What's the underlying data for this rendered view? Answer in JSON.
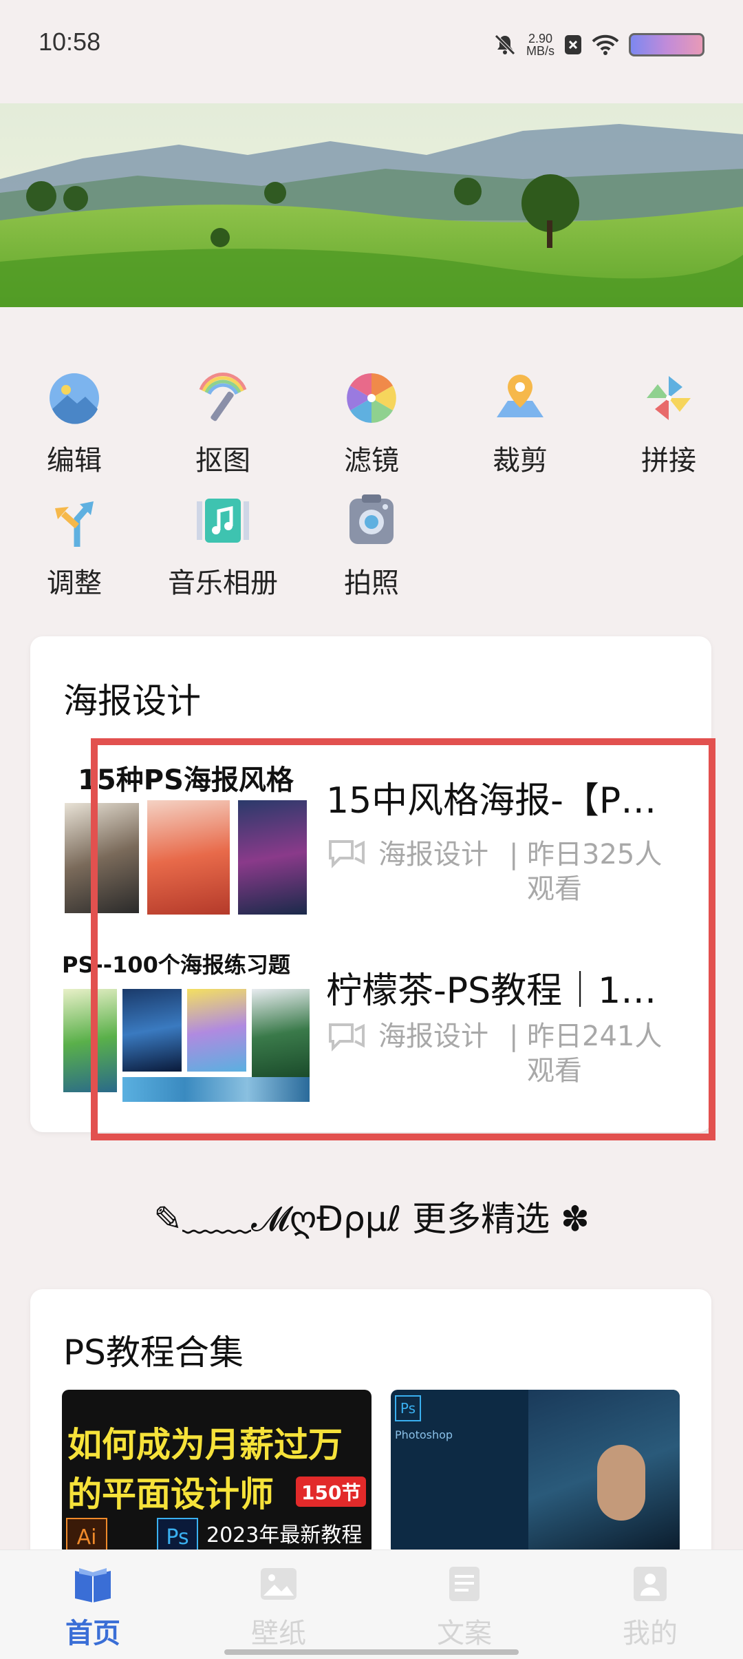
{
  "status_bar": {
    "time": "10:58",
    "net_speed_value": "2.90",
    "net_speed_unit": "MB/s"
  },
  "tools": [
    {
      "label": "编辑",
      "icon": "landscape-photo-icon"
    },
    {
      "label": "抠图",
      "icon": "magic-wand-icon"
    },
    {
      "label": "滤镜",
      "icon": "color-wheel-icon"
    },
    {
      "label": "裁剪",
      "icon": "map-pin-icon"
    },
    {
      "label": "拼接",
      "icon": "pinwheel-icon"
    },
    {
      "label": "调整",
      "icon": "split-arrow-icon"
    },
    {
      "label": "音乐相册",
      "icon": "music-album-icon"
    },
    {
      "label": "拍照",
      "icon": "camera-icon"
    }
  ],
  "poster_section": {
    "title": "海报设计",
    "items": [
      {
        "thumb_text": "15种PS海报风格",
        "title": "15中风格海报-【P…",
        "category": "海报设计",
        "stats_line1": "昨日325人",
        "stats_line2": "观看"
      },
      {
        "thumb_text": "PS--100个海报练习题",
        "title": "柠檬茶-PS教程｜1…",
        "category": "海报设计",
        "stats_line1": "昨日241人",
        "stats_line2": "观看"
      }
    ]
  },
  "more_picks": "✎﹏﹏𝓜ღĐρµℓ 更多精选 ✽",
  "ps_section": {
    "title": "PS教程合集",
    "card1_line1": "如何成为月薪过万",
    "card1_line2": "的平面设计师",
    "card1_badge": "150节",
    "card1_sub": "2023年最新教程",
    "card2_label": "Photoshop"
  },
  "bottom_nav": [
    {
      "label": "首页",
      "active": true
    },
    {
      "label": "壁纸",
      "active": false
    },
    {
      "label": "文案",
      "active": false
    },
    {
      "label": "我的",
      "active": false
    }
  ],
  "colors": {
    "accent": "#3a6ed6",
    "highlight": "#e2514f",
    "meta_gray": "#a8a8a8"
  }
}
